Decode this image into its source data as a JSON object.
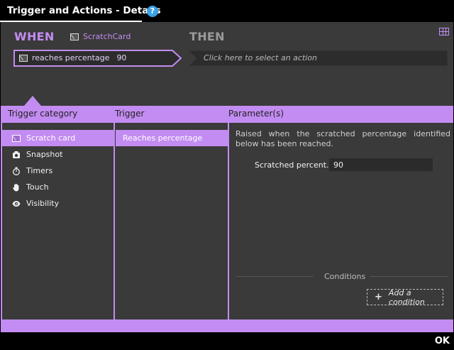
{
  "window": {
    "title": "Trigger and Actions - Details",
    "help_icon": "question-circle-icon",
    "help_label": "?"
  },
  "when": {
    "label": "WHEN",
    "widget_name": "ScratchCard",
    "widget_icon": "scratch-card-icon",
    "trigger_text": "reaches percentage",
    "trigger_value": "90"
  },
  "then": {
    "label": "THEN",
    "action_placeholder": "Click here to select an action"
  },
  "columns": {
    "category": "Trigger category",
    "trigger": "Trigger",
    "parameters": "Parameter(s)"
  },
  "categories": [
    {
      "label": "Scratch card",
      "icon": "scratch-card-icon",
      "selected": true
    },
    {
      "label": "Snapshot",
      "icon": "snapshot-icon",
      "selected": false
    },
    {
      "label": "Timers",
      "icon": "stopwatch-icon",
      "selected": false
    },
    {
      "label": "Touch",
      "icon": "hand-icon",
      "selected": false
    },
    {
      "label": "Visibility",
      "icon": "eye-icon",
      "selected": false
    }
  ],
  "triggers": [
    {
      "label": "Reaches percentage",
      "selected": true
    }
  ],
  "parameters": {
    "description": "Raised when the scratched percentage identified below has been reached.",
    "field_label": "Scratched percent...",
    "field_value": "90"
  },
  "conditions": {
    "label": "Conditions",
    "add_plus": "+",
    "add_label": "Add a condition"
  },
  "footer": {
    "ok_label": "OK"
  },
  "colors": {
    "accent": "#c38cf2",
    "panel": "#3a3a3a",
    "title_bar": "#000000",
    "help": "#3aa1e6"
  }
}
